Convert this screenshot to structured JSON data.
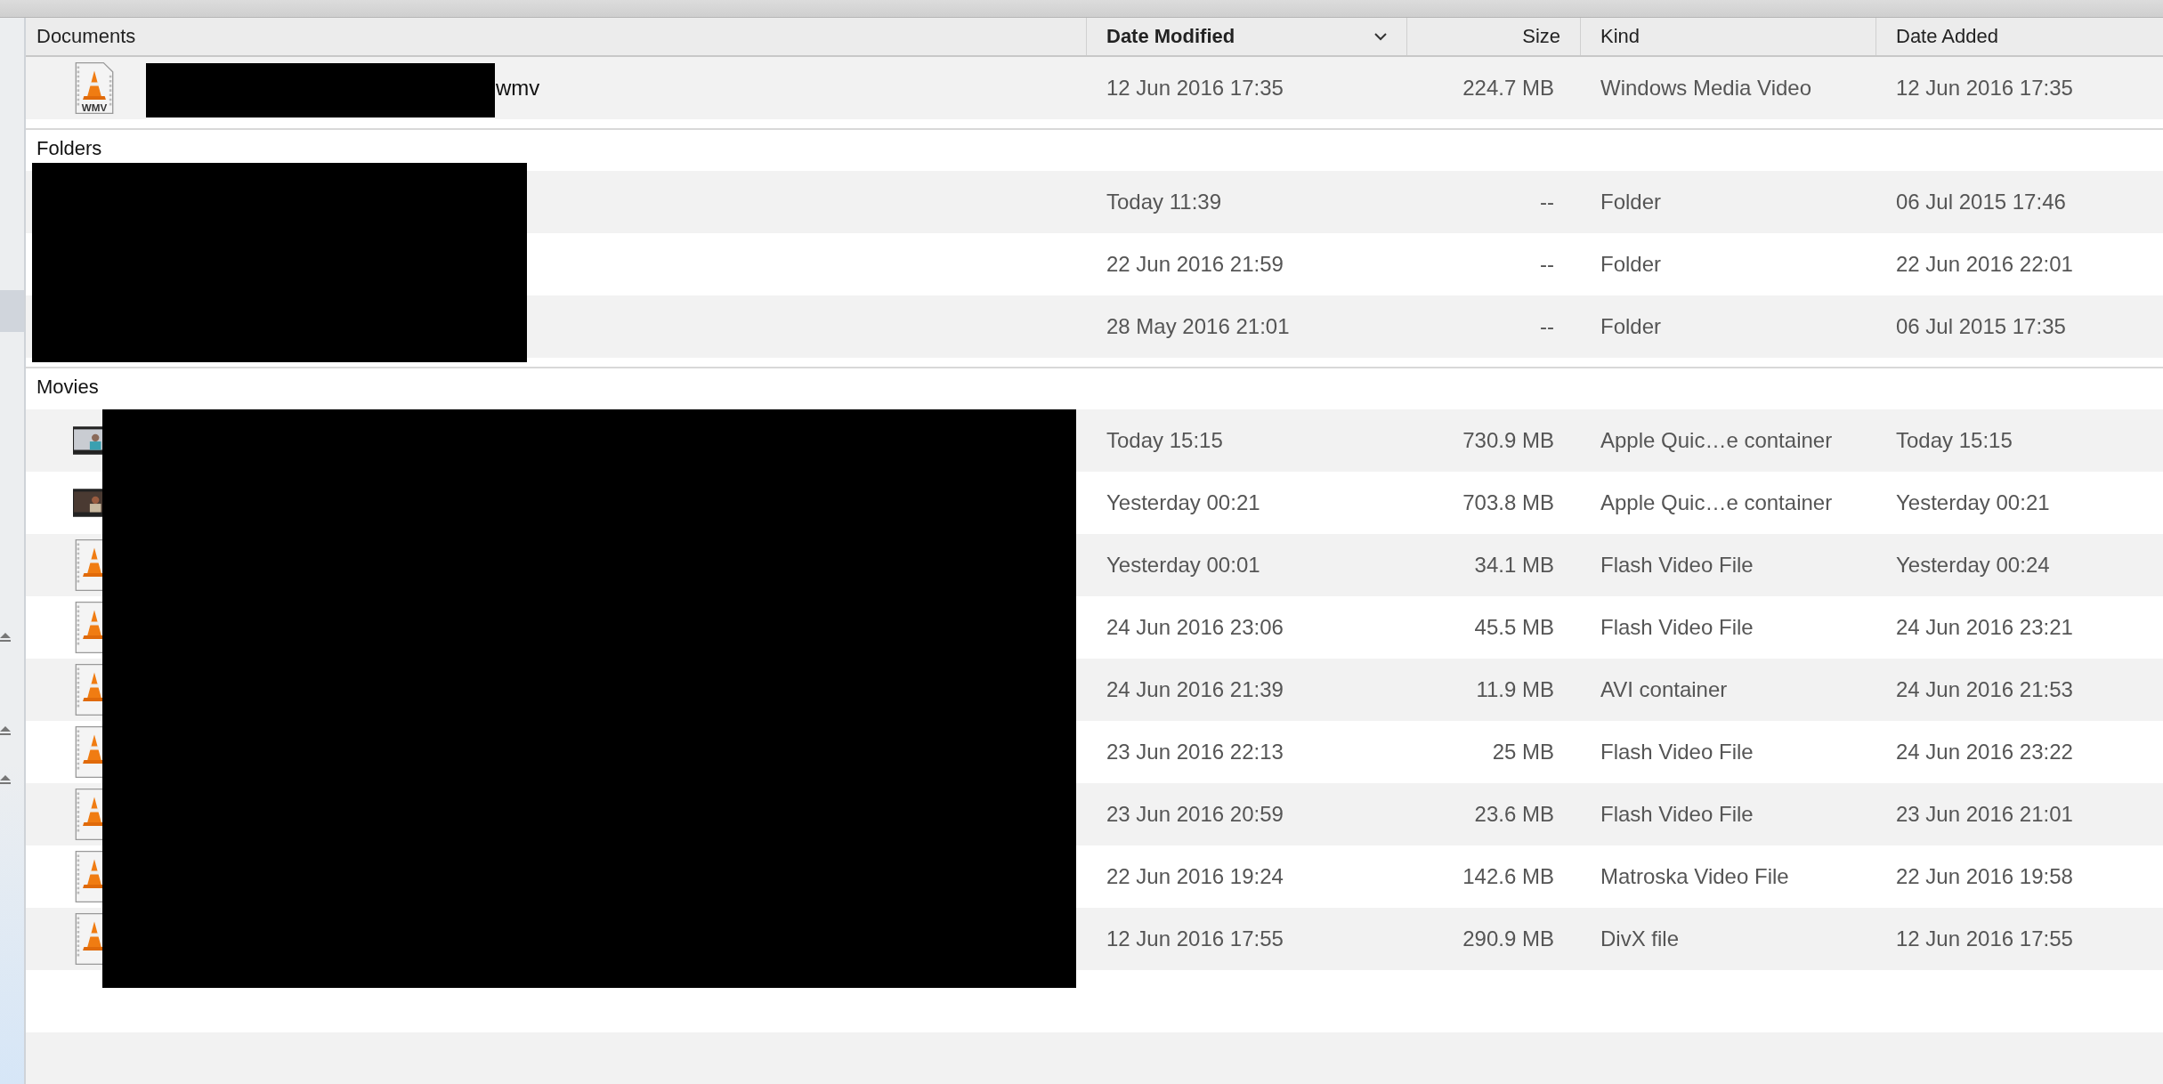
{
  "columns": [
    {
      "label": "Documents",
      "sorted": false
    },
    {
      "label": "Date Modified",
      "sorted": true
    },
    {
      "label": "Size",
      "sorted": false
    },
    {
      "label": "Kind",
      "sorted": false
    },
    {
      "label": "Date Added",
      "sorted": false
    }
  ],
  "groups": [
    {
      "rows": [
        {
          "kind": "vlc",
          "icon_label": "WMV",
          "name": "wmv",
          "modified": "12 Jun 2016 17:35",
          "size": "224.7 MB",
          "type": "Windows Media Video",
          "added": "12 Jun 2016 17:35"
        }
      ]
    },
    {
      "title": "Folders",
      "rows": [
        {
          "kind": "folder",
          "modified": "Today 11:39",
          "size": "--",
          "type": "Folder",
          "added": "06 Jul 2015 17:46"
        },
        {
          "kind": "folder",
          "modified": "22 Jun 2016 21:59",
          "size": "--",
          "type": "Folder",
          "added": "22 Jun 2016 22:01"
        },
        {
          "kind": "folder",
          "modified": "28 May 2016 21:01",
          "size": "--",
          "type": "Folder",
          "added": "06 Jul 2015 17:35"
        }
      ]
    },
    {
      "title": "Movies",
      "rows": [
        {
          "kind": "thumb",
          "modified": "Today 15:15",
          "size": "730.9 MB",
          "type": "Apple Quic…e container",
          "added": "Today 15:15"
        },
        {
          "kind": "thumb",
          "modified": "Yesterday 00:21",
          "size": "703.8 MB",
          "type": "Apple Quic…e container",
          "added": "Yesterday 00:21"
        },
        {
          "kind": "vlc",
          "modified": "Yesterday 00:01",
          "size": "34.1 MB",
          "type": "Flash Video File",
          "added": "Yesterday 00:24"
        },
        {
          "kind": "vlc",
          "modified": "24 Jun 2016 23:06",
          "size": "45.5 MB",
          "type": "Flash Video File",
          "added": "24 Jun 2016 23:21"
        },
        {
          "kind": "vlc",
          "modified": "24 Jun 2016 21:39",
          "size": "11.9 MB",
          "type": "AVI container",
          "added": "24 Jun 2016 21:53"
        },
        {
          "kind": "vlc",
          "modified": "23 Jun 2016 22:13",
          "size": "25 MB",
          "type": "Flash Video File",
          "added": "24 Jun 2016 23:22"
        },
        {
          "kind": "vlc",
          "modified": "23 Jun 2016 20:59",
          "size": "23.6 MB",
          "type": "Flash Video File",
          "added": "23 Jun 2016 21:01"
        },
        {
          "kind": "vlc",
          "modified": "22 Jun 2016 19:24",
          "size": "142.6 MB",
          "type": "Matroska Video File",
          "added": "22 Jun 2016 19:58"
        },
        {
          "kind": "vlc",
          "modified": "12 Jun 2016 17:55",
          "size": "290.9 MB",
          "type": "DivX file",
          "added": "12 Jun 2016 17:55"
        }
      ]
    }
  ]
}
